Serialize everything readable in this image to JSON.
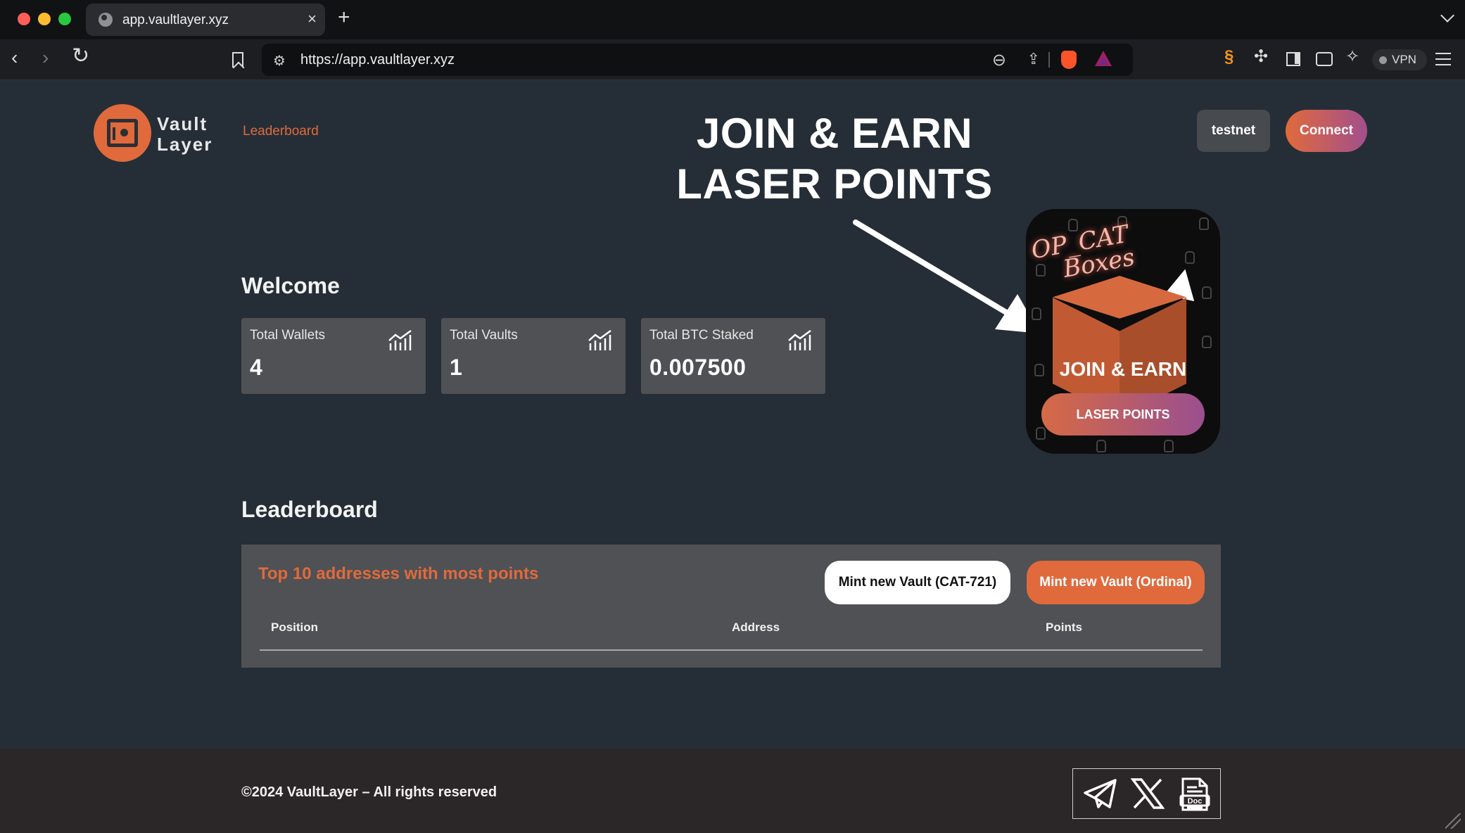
{
  "browser": {
    "tab_title": "app.vaultlayer.xyz",
    "tab_close": "×",
    "new_tab": "+",
    "url": "https://app.vaultlayer.xyz",
    "vpn_label": "VPN",
    "icons": [
      "back-icon",
      "forward-icon",
      "reload-icon",
      "bookmark-icon",
      "site-settings-icon",
      "zoom-out-icon",
      "share-icon",
      "brave-shields-icon",
      "brave-rewards-icon",
      "extension-icon",
      "puzzle-icon",
      "sidebar-icon",
      "wallet-icon",
      "leo-ai-icon",
      "menu-icon"
    ]
  },
  "header": {
    "logo_line1": "Vault",
    "logo_line2": "Layer",
    "nav_leaderboard": "Leaderboard",
    "network_button": "testnet",
    "connect_button": "Connect"
  },
  "overlay": {
    "line1": "JOIN & EARN",
    "line2": "LASER POINTS"
  },
  "promo": {
    "handwriting_line1": "OP_CAT",
    "handwriting_line2": "Boxes",
    "join_text": "JOIN & EARN",
    "button_label": "LASER POINTS"
  },
  "welcome": {
    "title": "Welcome",
    "stats": [
      {
        "label": "Total Wallets",
        "value": "4"
      },
      {
        "label": "Total Vaults",
        "value": "1"
      },
      {
        "label": "Total BTC Staked",
        "value": "0.007500"
      }
    ]
  },
  "leaderboard": {
    "title": "Leaderboard",
    "subtitle": "Top 10 addresses with most points",
    "mint_cat_button": "Mint new Vault (CAT-721)",
    "mint_ordinal_button": "Mint new Vault (Ordinal)",
    "columns": [
      "Position",
      "Address",
      "Points"
    ],
    "rows": []
  },
  "footer": {
    "copyright": "©2024 VaultLayer – All rights reserved",
    "social_icons": [
      "telegram-icon",
      "x-icon",
      "doc-icon"
    ]
  },
  "colors": {
    "accent": "#e06a3c",
    "page_bg": "#252e36",
    "card_bg": "#4f5154",
    "footer_bg": "#2b2628"
  }
}
